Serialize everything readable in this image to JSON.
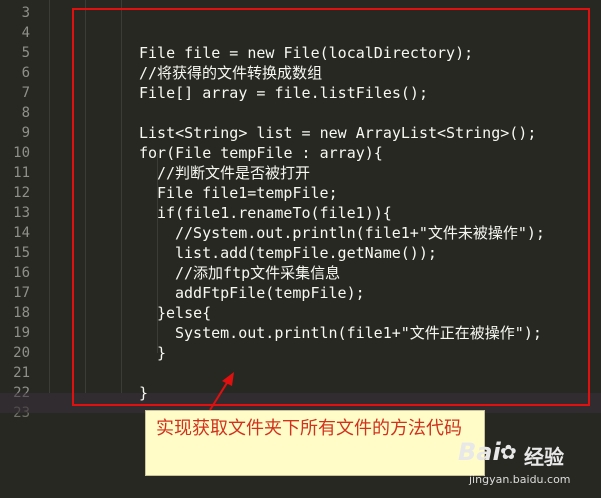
{
  "editor": {
    "line_numbers": [
      "3",
      "4",
      "5",
      "6",
      "7",
      "8",
      "9",
      "10",
      "11",
      "12",
      "13",
      "14",
      "15",
      "16",
      "17",
      "18",
      "19",
      "20",
      "21",
      "22",
      "23"
    ],
    "lines": [
      {
        "indent": 0,
        "text": ""
      },
      {
        "indent": 0,
        "text": ""
      },
      {
        "indent": 0,
        "text": "File file = new File(localDirectory);"
      },
      {
        "indent": 0,
        "text": "//将获得的文件转换成数组"
      },
      {
        "indent": 0,
        "text": "File[] array = file.listFiles();"
      },
      {
        "indent": 0,
        "text": ""
      },
      {
        "indent": 0,
        "text": "List<String> list = new ArrayList<String>();"
      },
      {
        "indent": 0,
        "text": "for(File tempFile : array){"
      },
      {
        "indent": 1,
        "text": "//判断文件是否被打开"
      },
      {
        "indent": 1,
        "text": "File file1=tempFile;"
      },
      {
        "indent": 1,
        "text": "if(file1.renameTo(file1)){"
      },
      {
        "indent": 2,
        "text": "//System.out.println(file1+\"文件未被操作\");"
      },
      {
        "indent": 2,
        "text": "list.add(tempFile.getName());"
      },
      {
        "indent": 2,
        "text": "//添加ftp文件采集信息"
      },
      {
        "indent": 2,
        "text": "addFtpFile(tempFile);"
      },
      {
        "indent": 1,
        "text": "}else{"
      },
      {
        "indent": 2,
        "text": "System.out.println(file1+\"文件正在被操作\");"
      },
      {
        "indent": 1,
        "text": "}"
      },
      {
        "indent": 0,
        "text": ""
      },
      {
        "indent": 0,
        "text": "}"
      },
      {
        "indent": 0,
        "text": ""
      }
    ]
  },
  "annotation": {
    "text": "实现获取文件夹下所有文件的方法代码",
    "box_color": "#e01010",
    "callout_bg": "#fffcc8",
    "text_color": "#d0321e"
  },
  "watermark": {
    "brand": "Bai",
    "brand_cn": "经验",
    "url": "jingyan.baidu.com"
  }
}
